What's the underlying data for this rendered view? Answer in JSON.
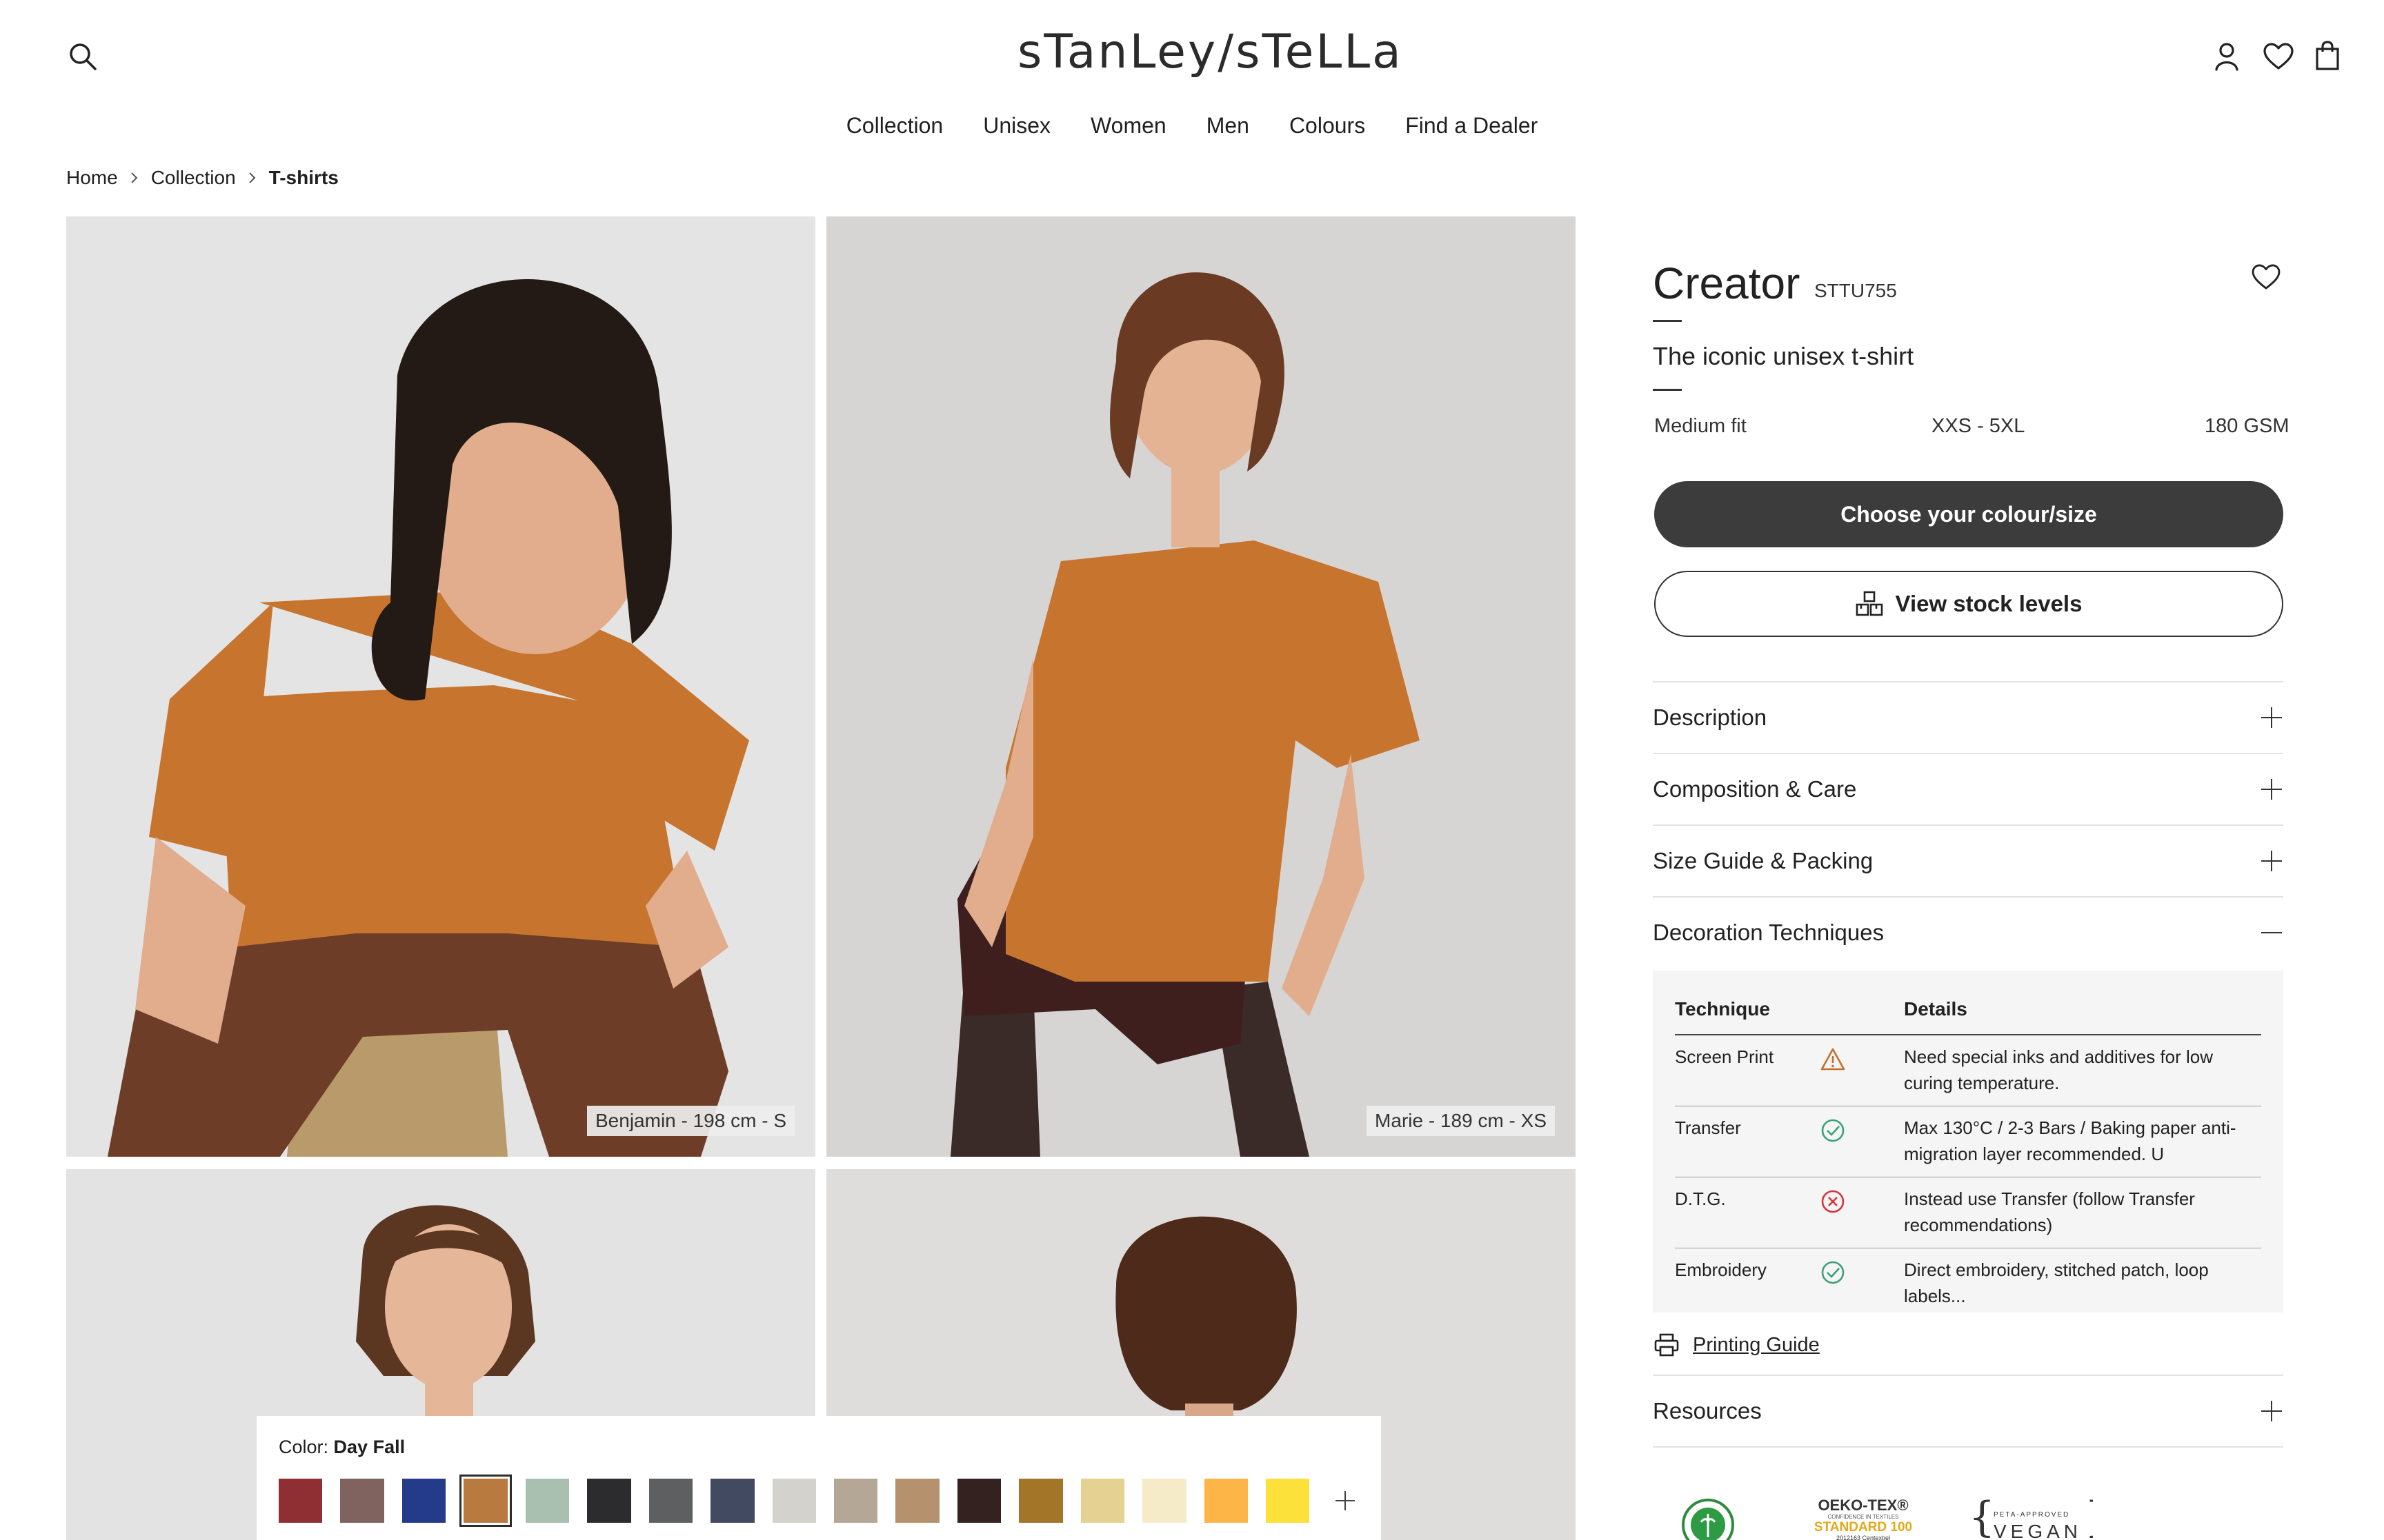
{
  "brand": {
    "logo_text": "sTanLey/sTeLLa"
  },
  "nav": {
    "items": [
      "Collection",
      "Unisex",
      "Women",
      "Men",
      "Colours",
      "Find a Dealer"
    ]
  },
  "breadcrumb": {
    "items": [
      "Home",
      "Collection",
      "T-shirts"
    ]
  },
  "gallery": {
    "captions": [
      "Benjamin - 198 cm - S",
      "Marie - 189 cm - XS"
    ]
  },
  "color_picker": {
    "label": "Color:",
    "selected": "Day Fall",
    "swatches": [
      "#8f2f34",
      "#80625f",
      "#233b8a",
      "#b87a3e",
      "#a9c0b0",
      "#2c2c2e",
      "#5e5f61",
      "#424a61",
      "#d3d2cc",
      "#b5a796",
      "#b5916d",
      "#33221f",
      "#a37529",
      "#e5d191",
      "#f5ebc8",
      "#fdb547",
      "#fde13b"
    ],
    "selected_index": 3
  },
  "product": {
    "name": "Creator",
    "sku": "STTU755",
    "tagline": "The iconic unisex t-shirt",
    "fit": "Medium fit",
    "sizes": "XXS - 5XL",
    "weight": "180 GSM",
    "primary_button": "Choose your colour/size",
    "stock_button": "View stock levels"
  },
  "accordion": {
    "description": "Description",
    "composition": "Composition & Care",
    "size_guide": "Size Guide & Packing",
    "decoration": "Decoration Techniques",
    "resources": "Resources"
  },
  "techniques": {
    "header_technique": "Technique",
    "header_details": "Details",
    "rows": [
      {
        "name": "Screen Print",
        "status": "warning",
        "details": "Need special inks and additives for low curing temperature."
      },
      {
        "name": "Transfer",
        "status": "ok",
        "details": "Max 130°C / 2-3 Bars / Baking paper anti-migration layer recommended. U"
      },
      {
        "name": "D.T.G.",
        "status": "no",
        "details": "Instead use Transfer (follow Transfer recommendations)"
      },
      {
        "name": "Embroidery",
        "status": "ok",
        "details": "Direct embroidery, stitched patch, loop labels..."
      }
    ]
  },
  "printing_guide": "Printing Guide",
  "certifications": {
    "oeko_title": "OEKO-TEX®",
    "oeko_small": "CONFIDENCE IN TEXTILES",
    "oeko_standard": "STANDARD 100",
    "oeko_code": "2012163 Centexbel",
    "peta": "PETA-APPROVED",
    "vegan": "VEGAN"
  },
  "colors": {
    "accent_dark": "#3c3c3c",
    "warning": "#c0712f",
    "ok": "#3aa17a",
    "no": "#d6333d",
    "tee": "#c7752e"
  }
}
